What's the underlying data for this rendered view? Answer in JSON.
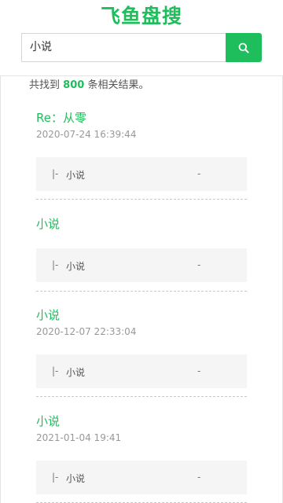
{
  "site": {
    "logo": "飞鱼盘搜"
  },
  "search": {
    "value": "小说"
  },
  "summary": {
    "prefix": "共找到",
    "count": "800",
    "suffix": "条相关结果。"
  },
  "results": [
    {
      "title": "Re：从零",
      "date": "2020-07-24 16:39:44",
      "file": {
        "branch": "|-",
        "name": "小说",
        "size": "-"
      }
    },
    {
      "title": "小说",
      "date": "",
      "file": {
        "branch": "|-",
        "name": "小说",
        "size": "-"
      }
    },
    {
      "title": "小说",
      "date": "2020-12-07 22:33:04",
      "file": {
        "branch": "|-",
        "name": "小说",
        "size": "-"
      }
    },
    {
      "title": "小说",
      "date": "2021-01-04 19:41",
      "file": {
        "branch": "|-",
        "name": "小说",
        "size": "-"
      }
    }
  ],
  "colors": {
    "accent": "#1fbe5c"
  },
  "icons": {
    "search_button": "search-icon"
  }
}
